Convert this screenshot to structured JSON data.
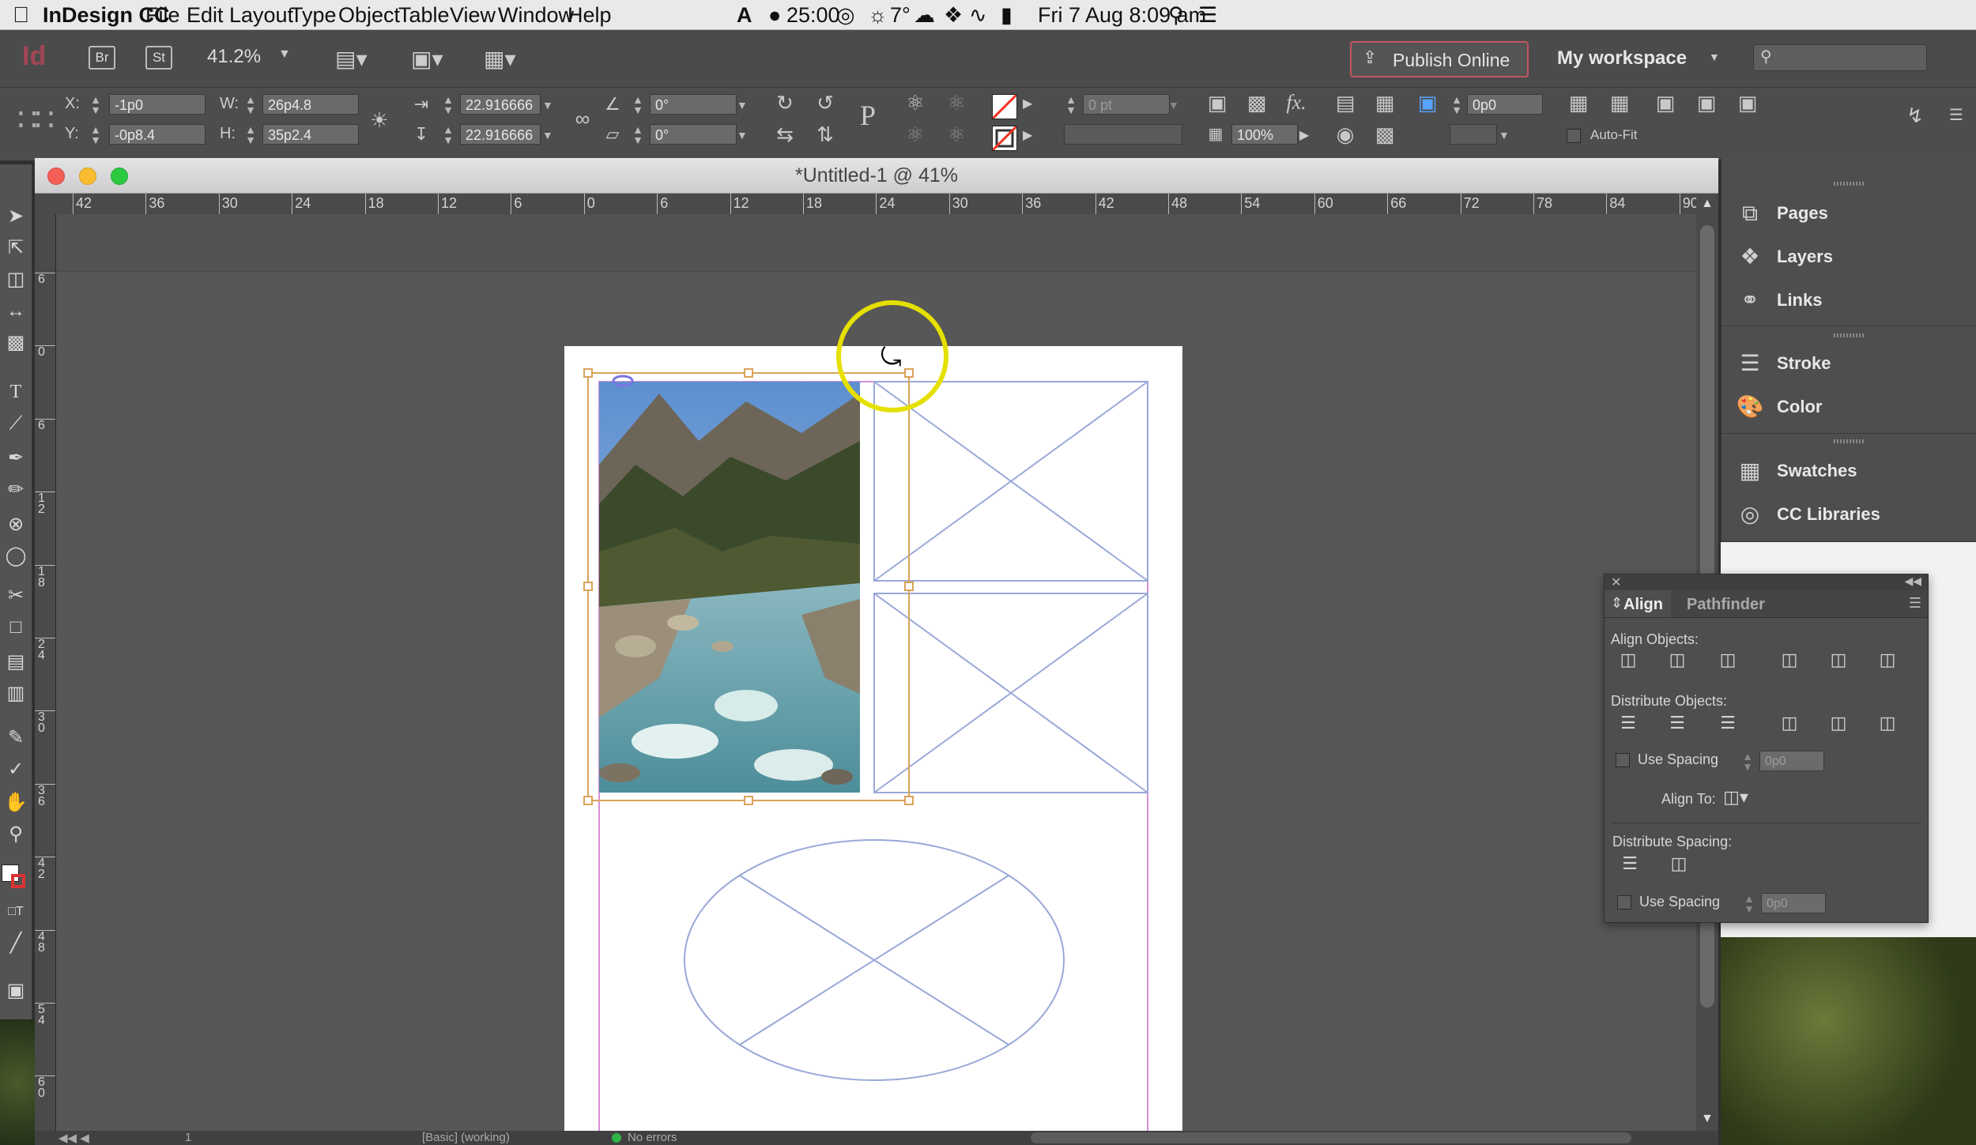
{
  "menubar": {
    "app_name": "InDesign CC",
    "items": [
      "File",
      "Edit",
      "Layout",
      "Type",
      "Object",
      "Table",
      "View",
      "Window",
      "Help"
    ],
    "status": {
      "timer": "25:00",
      "weather": "7°",
      "datetime": "Fri 7 Aug  8:09 am"
    }
  },
  "appbar": {
    "logo": "Id",
    "bridge": "Br",
    "stock": "St",
    "zoom": "41.2%",
    "publish_label": "Publish Online",
    "workspace": "My workspace",
    "search_placeholder": ""
  },
  "control": {
    "x_label": "X:",
    "y_label": "Y:",
    "w_label": "W:",
    "h_label": "H:",
    "x": "-1p0",
    "y": "-0p8.4",
    "w": "26p4.8",
    "h": "35p2.4",
    "scale_x": "22.916666",
    "scale_y": "22.916666",
    "rotate": "0°",
    "shear": "0°",
    "stroke_weight": "0 pt",
    "opacity": "100%",
    "offset": "0p0",
    "autofit_label": "Auto-Fit"
  },
  "document": {
    "title": "*Untitled-1 @ 41%",
    "ruler_h": [
      "42",
      "36",
      "30",
      "24",
      "18",
      "12",
      "6",
      "0",
      "6",
      "12",
      "18",
      "24",
      "30",
      "36",
      "42",
      "48",
      "54",
      "60",
      "66",
      "72",
      "78",
      "84",
      "90"
    ],
    "ruler_v": [
      "6",
      "0",
      "6",
      "1 2",
      "1 8",
      "2 4",
      "3 0",
      "3 6",
      "4 2",
      "4 8",
      "5 4",
      "6 0"
    ]
  },
  "statusbar": {
    "page": "1",
    "profile": "[Basic] (working)",
    "preflight": "No errors"
  },
  "panels": {
    "items": [
      {
        "label": "Pages",
        "icon": "pages-icon"
      },
      {
        "label": "Layers",
        "icon": "layers-icon"
      },
      {
        "label": "Links",
        "icon": "links-icon"
      },
      {
        "label": "Stroke",
        "icon": "stroke-icon"
      },
      {
        "label": "Color",
        "icon": "color-icon"
      },
      {
        "label": "Swatches",
        "icon": "swatches-icon"
      },
      {
        "label": "CC Libraries",
        "icon": "cc-libraries-icon"
      }
    ]
  },
  "align_panel": {
    "tab_align": "Align",
    "tab_pathfinder": "Pathfinder",
    "align_objects": "Align Objects:",
    "distribute_objects": "Distribute Objects:",
    "use_spacing": "Use Spacing",
    "spacing_value": "0p0",
    "align_to": "Align To:",
    "distribute_spacing": "Distribute Spacing:"
  },
  "colors": {
    "accent_yellow": "#e6e000",
    "frame_blue": "#9aa8d8",
    "margin_magenta": "#d080d0",
    "selection_orange": "#d9a35a"
  }
}
